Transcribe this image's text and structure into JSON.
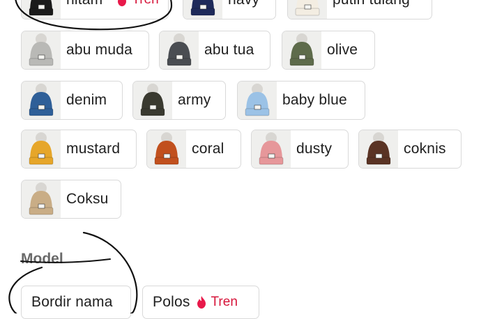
{
  "colors_section": {
    "variants": [
      {
        "label": "hitam",
        "badge": "Tren",
        "color": "#1b1b1b"
      },
      {
        "label": "navy",
        "color": "#1e2a5a"
      },
      {
        "label": "putih tulang",
        "color": "#f3ede2"
      },
      {
        "label": "abu muda",
        "color": "#b9b9b6"
      },
      {
        "label": "abu tua",
        "color": "#4a4d52"
      },
      {
        "label": "olive",
        "color": "#5e6b4b"
      },
      {
        "label": "denim",
        "color": "#2f5f98"
      },
      {
        "label": "army",
        "color": "#3a3a30"
      },
      {
        "label": "baby blue",
        "color": "#9bc2e6"
      },
      {
        "label": "mustard",
        "color": "#e6a62a"
      },
      {
        "label": "coral",
        "color": "#c1501e"
      },
      {
        "label": "dusty",
        "color": "#e6979a"
      },
      {
        "label": "coknis",
        "color": "#5a3324"
      },
      {
        "label": "Coksu",
        "color": "#c9ad86"
      }
    ]
  },
  "model_section": {
    "title": "Model",
    "options": [
      {
        "label": "Bordir nama"
      },
      {
        "label": "Polos",
        "badge": "Tren"
      }
    ]
  },
  "accent_color": "#d6153a"
}
